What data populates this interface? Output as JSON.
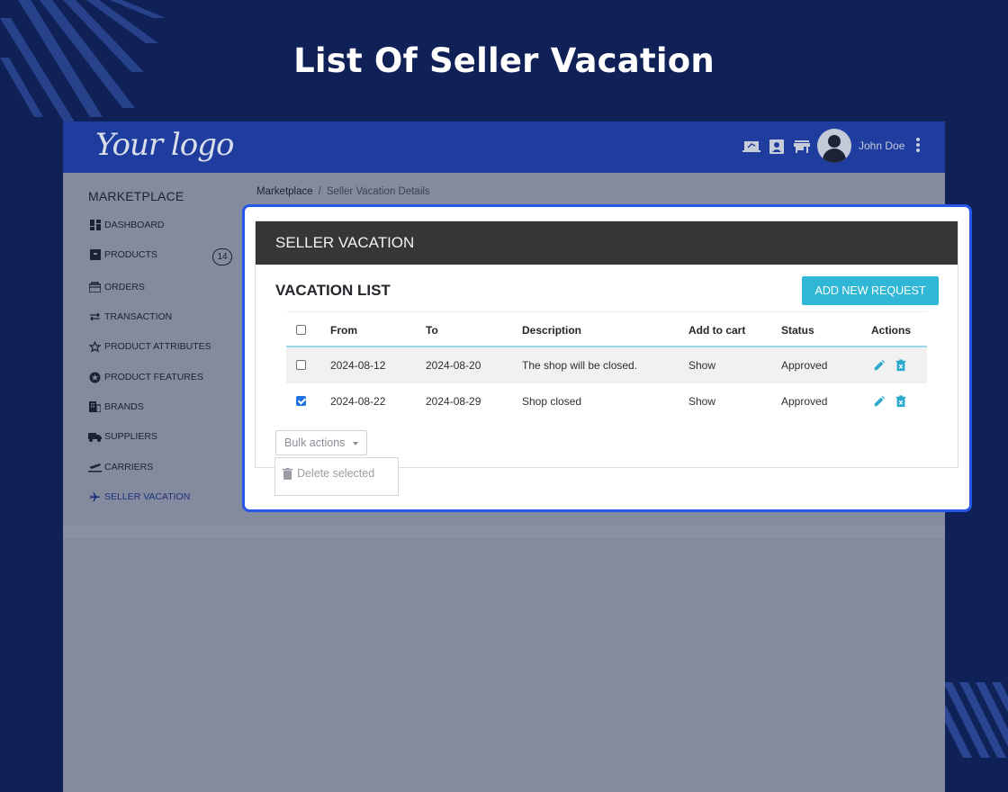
{
  "hero": {
    "title": "List Of Seller Vacation"
  },
  "topbar": {
    "logo": "Your logo",
    "icons": [
      "laptop-icon",
      "contact-card-icon",
      "store-icon"
    ],
    "user_name": "John Doe"
  },
  "sidebar": {
    "title": "MARKETPLACE",
    "items": [
      {
        "label": "DASHBOARD",
        "icon": "dashboard-icon"
      },
      {
        "label": "PRODUCTS",
        "icon": "box-icon",
        "badge": "14"
      },
      {
        "label": "ORDERS",
        "icon": "basket-icon"
      },
      {
        "label": "TRANSACTION",
        "icon": "swap-icon"
      },
      {
        "label": "PRODUCT ATTRIBUTES",
        "icon": "star-icon"
      },
      {
        "label": "PRODUCT FEATURES",
        "icon": "star-circle-icon"
      },
      {
        "label": "BRANDS",
        "icon": "building-icon"
      },
      {
        "label": "SUPPLIERS",
        "icon": "truck-icon"
      },
      {
        "label": "CARRIERS",
        "icon": "plane-takeoff-icon"
      },
      {
        "label": "SELLER VACATION",
        "icon": "airplane-icon",
        "active": true
      }
    ]
  },
  "breadcrumb": {
    "root": "Marketplace",
    "separator": "/",
    "current": "Seller Vacation Details"
  },
  "card": {
    "header": "SELLER VACATION",
    "list_title": "VACATION LIST",
    "add_button": "ADD NEW REQUEST",
    "columns": [
      "From",
      "To",
      "Description",
      "Add to cart",
      "Status",
      "Actions"
    ],
    "rows": [
      {
        "checked": false,
        "from": "2024-08-12",
        "to": "2024-08-20",
        "description": "The shop will be closed.",
        "add_to_cart": "Show",
        "status": "Approved"
      },
      {
        "checked": true,
        "from": "2024-08-22",
        "to": "2024-08-29",
        "description": "Shop closed",
        "add_to_cart": "Show",
        "status": "Approved"
      }
    ],
    "bulk_actions": "Bulk actions",
    "bulk_menu": {
      "delete_selected": "Delete selected"
    }
  },
  "colors": {
    "page_bg": "#0f2157",
    "topbar": "#1f3d9e",
    "accent": "#31b7d6",
    "highlight_border": "#2757e8",
    "card_header": "#363636"
  }
}
